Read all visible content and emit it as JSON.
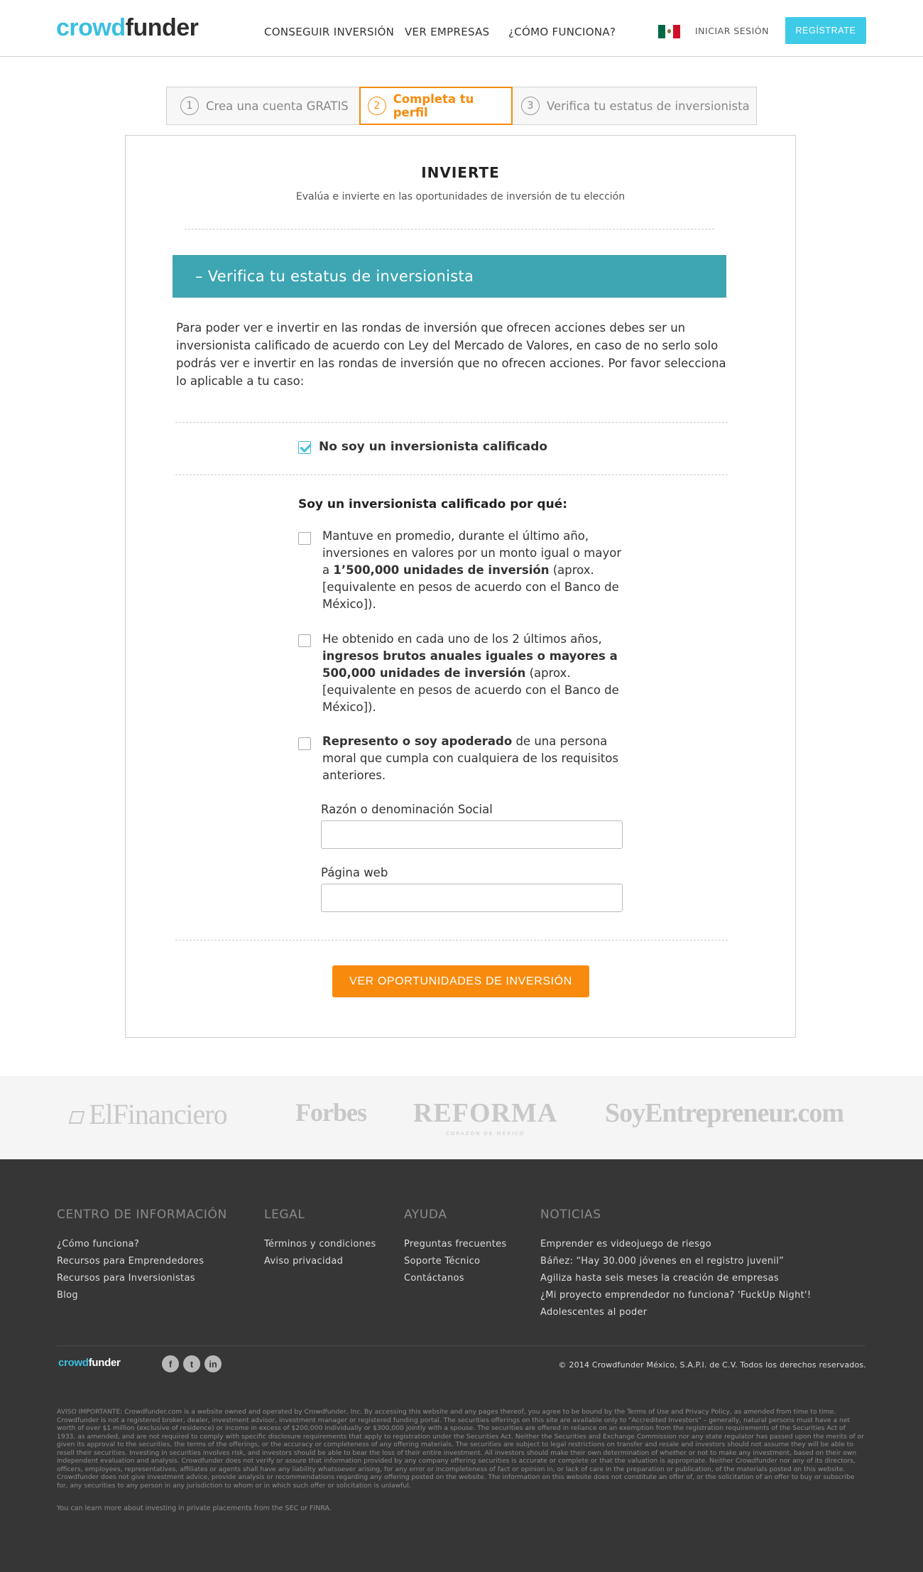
{
  "header": {
    "logo_part1": "crowd",
    "logo_part2": "funder",
    "nav": [
      "CONSEGUIR INVERSIÓN",
      "VER EMPRESAS",
      "¿CÓMO FUNCIONA?"
    ],
    "login": "INICIAR SESIÓN",
    "register": "REGÍSTRATE"
  },
  "steps": [
    {
      "num": "1",
      "label": "Crea una cuenta GRATIS"
    },
    {
      "num": "2",
      "label": "Completa tu perfil"
    },
    {
      "num": "3",
      "label": "Verifica tu estatus de inversionista"
    }
  ],
  "card": {
    "title": "INVIERTE",
    "subtitle": "Evalúa e invierte en las oportunidades de inversión de tu elección",
    "banner": "– Verifica tu estatus de inversionista",
    "intro": "Para poder ver e invertir en las rondas de inversión que ofrecen acciones debes ser un inversionista calificado de acuerdo con Ley del Mercado de Valores, en caso de no serlo solo podrás ver e invertir en las rondas de inversión que no ofrecen acciones. Por favor selecciona lo aplicable a tu caso:",
    "not_qualified_label": "No soy un inversionista calificado",
    "not_qualified_checked": true,
    "qualified_title": "Soy un inversionista calificado por qué:",
    "options": [
      {
        "pre": "Mantuve en promedio, durante el último año, inversiones en valores por un monto igual o mayor a ",
        "bold": "1’500,000 unidades de inversión",
        "post": " (aprox. [equivalente en pesos de acuerdo con el Banco de México]).",
        "checked": false
      },
      {
        "pre": "He obtenido en cada uno de los 2 últimos años, ",
        "bold": "ingresos brutos anuales iguales o mayores a 500,000 unidades de inversión",
        "post": " (aprox. [equivalente en pesos de acuerdo con el Banco de México]).",
        "checked": false
      },
      {
        "pre": "",
        "bold": "Represento o soy apoderado",
        "post": " de una persona moral que cumpla con cualquiera de los requisitos anteriores.",
        "checked": false
      }
    ],
    "field_company_label": "Razón o denominación Social",
    "field_company_value": "",
    "field_web_label": "Página web",
    "field_web_value": "",
    "cta": "VER OPORTUNIDADES DE INVERSIÓN"
  },
  "press": {
    "logos": [
      "ElFinanciero",
      "Forbes",
      "REFORMA",
      "SoyEntrepreneur.com"
    ],
    "reforma_tagline": "CORAZÓN DE MÉXICO"
  },
  "footer": {
    "columns": [
      {
        "heading": "CENTRO DE INFORMACIÓN",
        "links": [
          "¿Cómo funciona?",
          "Recursos para Emprendedores",
          "Recursos para Inversionistas",
          "Blog"
        ]
      },
      {
        "heading": "LEGAL",
        "links": [
          "Términos y condiciones",
          "Aviso privacidad"
        ]
      },
      {
        "heading": "AYUDA",
        "links": [
          "Preguntas frecuentes",
          "Soporte Técnico",
          "Contáctanos"
        ]
      },
      {
        "heading": "NOTICIAS",
        "links": [
          "Emprender es videojuego de riesgo",
          "Báñez: “Hay 30.000 jóvenes en el registro juvenil”",
          "Agiliza hasta seis meses la creación de empresas",
          "¿Mi proyecto emprendedor no funciona? 'FuckUp Night'!",
          "Adolescentes al poder"
        ]
      }
    ],
    "logo_part1": "crowd",
    "logo_part2": "funder",
    "social": [
      "f",
      "t",
      "in"
    ],
    "copyright": "© 2014 Crowdfunder México, S.A.P.I. de C.V. Todos los derechos reservados.",
    "disclaimer": "AVISO IMPORTANTE: Crowdfunder.com is a website owned and operated by Crowdfunder, Inc. By accessing this website and any pages thereof, you agree to be bound by the Terms of Use and Privacy Policy, as amended from time to time. Crowdfunder is not a registered broker, dealer, investment advisor, investment manager or registered funding portal. The securities offerings on this site are available only to \"Accredited Investors\" – generally, natural persons must have a net worth of over $1 million (exclusive of residence) or income in excess of $200,000 individually or $300,000 jointly with a spouse. The securities are offered in reliance on an exemption from the registration requirements of the Securities Act of 1933, as amended, and are not required to comply with specific disclosure requirements that apply to registration under the Securities Act. Neither the Securities and Exchange Commission nor any state regulator has passed upon the merits of or given its approval to the securities, the terms of the offerings, or the accuracy or completeness of any offering materials. The securities are subject to legal restrictions on transfer and resale and investors should not assume they will be able to resell their securities. Investing in securities involves risk, and investors should be able to bear the loss of their entire investment. All investors should make their own determination of whether or not to make any investment, based on their own independent evaluation and analysis. Crowdfunder does not verify or assure that information provided by any company offering securities is accurate or complete or that the valuation is appropriate. Neither Crowdfunder nor any of its directors, officers, employees, representatives, affiliates or agents shall have any liability whatsoever arising, for any error or incompleteness of fact or opinion in, or lack of care in the preparation or publication, of the materials posted on this website. Crowdfunder does not give investment advice, provide analysis or recommendations regarding any offering posted on the website. The information on this website does not constitute an offer of, or the solicitation of an offer to buy or subscribe for, any securities to any person in any jurisdiction to whom or in which such offer or solicitation is unlawful.",
    "learn_more": "You can learn more about investing in private placements from the SEC or FINRA."
  },
  "colors": {
    "brand_blue": "#3bbfe0",
    "banner_teal": "#3ea5b2",
    "accent_orange": "#f88b0d",
    "footer_bg": "#363636"
  }
}
